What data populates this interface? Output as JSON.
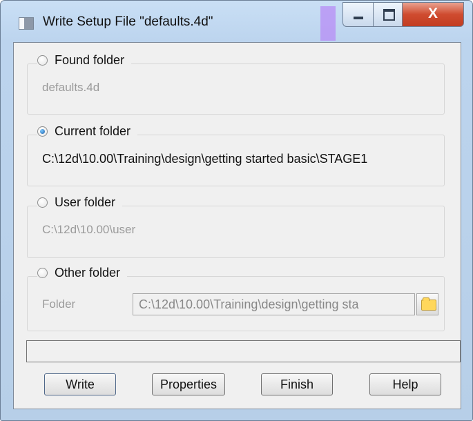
{
  "window": {
    "title": "Write Setup File \"defaults.4d\""
  },
  "groups": [
    {
      "label": "Found folder",
      "path": "defaults.4d",
      "checked": false
    },
    {
      "label": "Current folder",
      "path": "C:\\12d\\10.00\\Training\\design\\getting started basic\\STAGE1",
      "checked": true
    },
    {
      "label": "User folder",
      "path": "C:\\12d\\10.00\\user",
      "checked": false
    },
    {
      "label": "Other folder",
      "folder_label": "Folder",
      "folder_value": "C:\\12d\\10.00\\Training\\design\\getting sta",
      "checked": false
    }
  ],
  "buttons": {
    "write": "Write",
    "properties": "Properties",
    "finish": "Finish",
    "help": "Help",
    "close": "X"
  },
  "colors": {
    "title_bg": "#c9dff5",
    "dialog_bg": "#f0f0f0",
    "close_red": "#cf4b2f",
    "radio_selected": "#1c5ea8"
  },
  "icons": {
    "app": "app-window-icon",
    "minimize": "minimize-icon",
    "maximize": "maximize-icon",
    "close": "close-icon",
    "folder": "folder-icon"
  }
}
